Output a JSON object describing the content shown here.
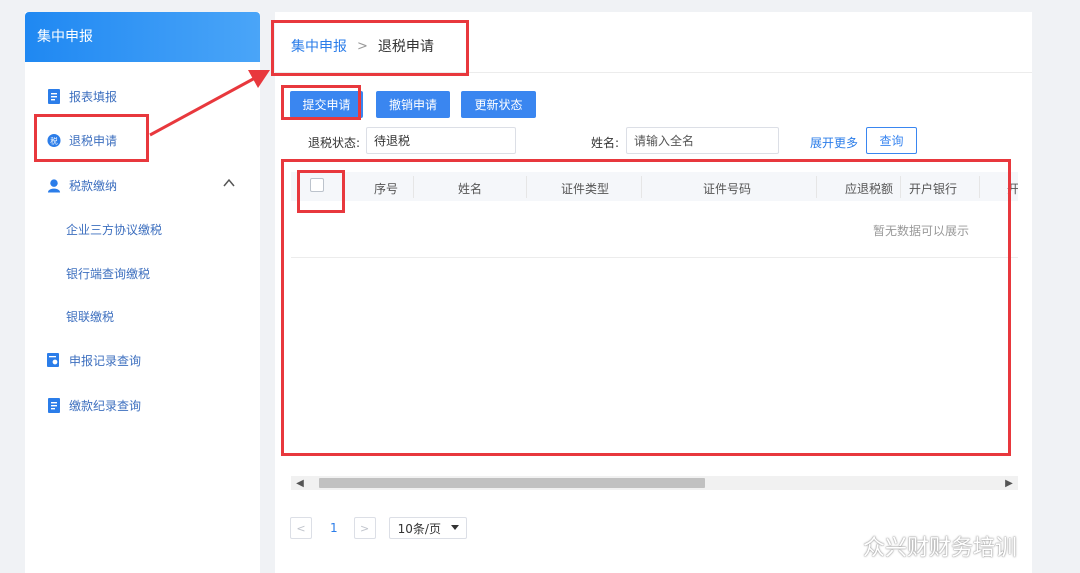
{
  "sidebar": {
    "title": "集中申报",
    "items": [
      {
        "label": "报表填报",
        "icon": "document-icon"
      },
      {
        "label": "退税申请",
        "icon": "refund-icon"
      },
      {
        "label": "税款缴纳",
        "icon": "user-icon"
      },
      {
        "label": "企业三方协议缴税"
      },
      {
        "label": "银行端查询缴税"
      },
      {
        "label": "银联缴税"
      },
      {
        "label": "申报记录查询",
        "icon": "search-record-icon"
      },
      {
        "label": "缴款纪录查询",
        "icon": "document-icon"
      }
    ]
  },
  "breadcrumb": {
    "parent": "集中申报",
    "separator": ">",
    "current": "退税申请"
  },
  "toolbar": {
    "submit": "提交申请",
    "revoke": "撤销申请",
    "refresh": "更新状态"
  },
  "filter": {
    "status_label": "退税状态:",
    "status_value": "待退税",
    "name_label": "姓名:",
    "name_placeholder": "请输入全名",
    "expand": "展开更多",
    "query": "查询"
  },
  "table": {
    "columns": [
      "序号",
      "姓名",
      "证件类型",
      "证件号码",
      "应退税额",
      "开户银行",
      "开"
    ],
    "empty_text": "暂无数据可以展示"
  },
  "pagination": {
    "prev": "<",
    "page": "1",
    "next": ">",
    "page_size": "10条/页"
  },
  "watermark": "众兴财财务培训",
  "colors": {
    "accent": "#3a86f0",
    "highlight": "#e8383d"
  }
}
